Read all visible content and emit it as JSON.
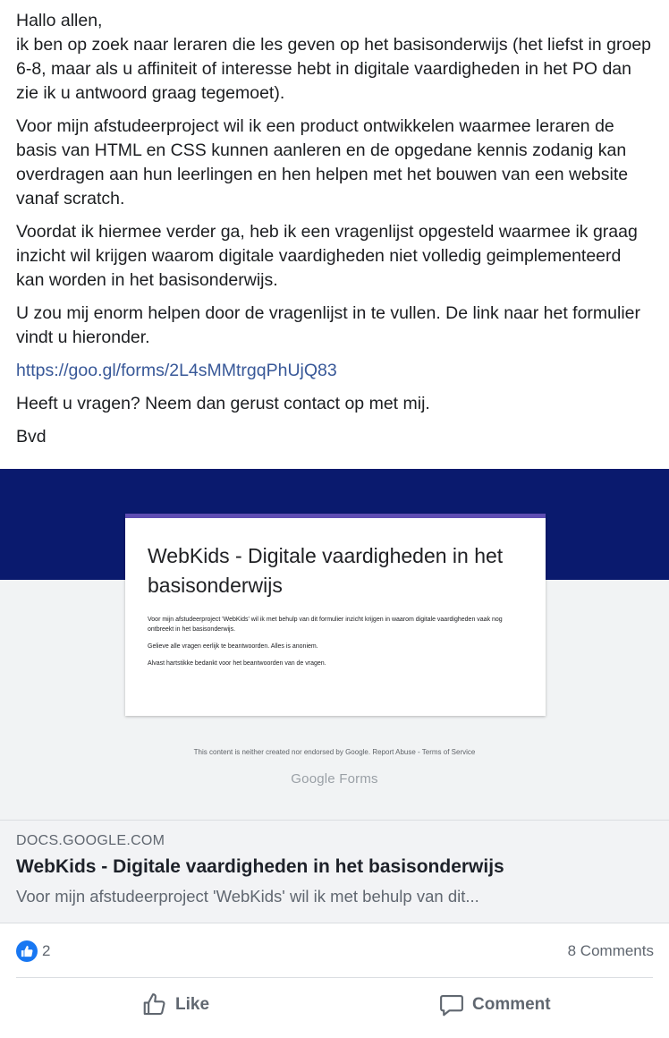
{
  "post": {
    "paragraphs": [
      "Hallo allen,",
      "ik ben op zoek naar leraren die les geven op het basisonderwijs (het liefst in groep 6-8, maar als u affiniteit of interesse hebt in digitale vaardigheden in het PO dan zie ik u antwoord graag tegemoet).",
      "Voor mijn afstudeerproject wil ik een product ontwikkelen waarmee leraren de basis van HTML en CSS kunnen aanleren en de opgedane kennis zodanig kan overdragen aan hun leerlingen en hen helpen met het bouwen van een website vanaf scratch.",
      "Voordat ik hiermee verder ga, heb ik een vragenlijst opgesteld waarmee ik graag inzicht wil krijgen waarom digitale vaardigheden niet volledig geimplementeerd kan worden in het basisonderwijs.",
      "U zou mij enorm helpen door de vragenlijst in te vullen. De link naar het formulier vindt u hieronder.",
      "Heeft u vragen? Neem dan gerust contact op met mij.",
      "Bvd"
    ],
    "link": "https://goo.gl/forms/2L4sMMtrgqPhUjQ83"
  },
  "preview": {
    "form_title": "WebKids - Digitale vaardigheden in het basisonderwijs",
    "form_description": [
      "Voor mijn afstudeerproject 'WebKids' wil ik met behulp van dit formulier inzicht krijgen in waarom digitale vaardigheden vaak nog ontbreekt in het basisonderwijs.",
      "Gelieve alle vragen eerlijk te beantwoorden. Alles is anoniem.",
      "Alvast hartstikke bedankt voor het beantwoorden van de vragen."
    ],
    "footer_text": "This content is neither created nor endorsed by Google. Report Abuse - Terms of Service",
    "logo_text": "Google Forms",
    "domain": "DOCS.GOOGLE.COM",
    "title": "WebKids - Digitale vaardigheden in het basisonderwijs",
    "description": "Voor mijn afstudeerproject 'WebKids' wil ik met behulp van dit...",
    "banner_color": "#0a1a6e",
    "accent_color": "#5e4db2"
  },
  "stats": {
    "like_count": "2",
    "comments": "8 Comments"
  },
  "actions": {
    "like_label": "Like",
    "comment_label": "Comment"
  },
  "icons": {
    "like_reaction": "thumbs-up-icon",
    "like_action": "thumbs-up-outline-icon",
    "comment_action": "speech-bubble-icon"
  }
}
